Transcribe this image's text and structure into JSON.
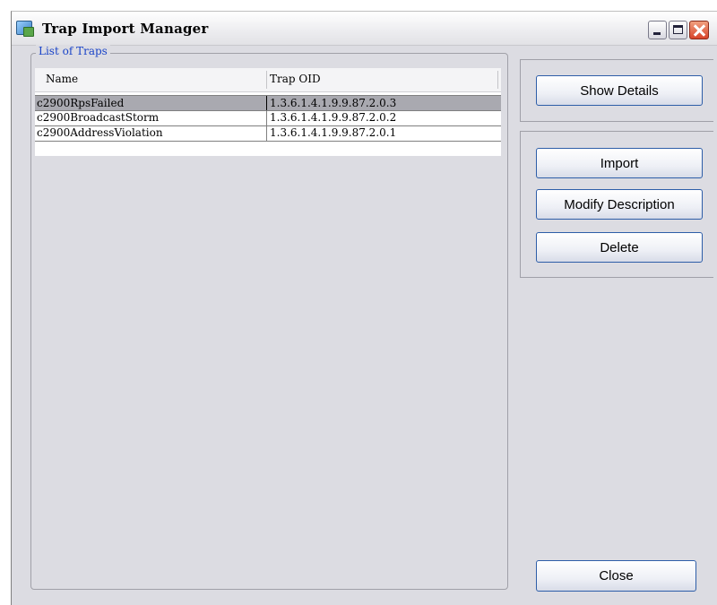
{
  "window": {
    "title": "Trap Import Manager",
    "icon": "app-icon"
  },
  "list": {
    "group_label": "List of Traps",
    "columns": [
      "Name",
      "Trap OID"
    ],
    "rows": [
      {
        "name": "c2900RpsFailed",
        "oid": "1.3.6.1.4.1.9.9.87.2.0.3",
        "selected": true
      },
      {
        "name": "c2900BroadcastStorm",
        "oid": "1.3.6.1.4.1.9.9.87.2.0.2",
        "selected": false
      },
      {
        "name": "c2900AddressViolation",
        "oid": "1.3.6.1.4.1.9.9.87.2.0.1",
        "selected": false
      }
    ]
  },
  "actions": {
    "show_details": "Show Details",
    "import": "Import",
    "modify_description": "Modify Description",
    "delete": "Delete",
    "close": "Close"
  },
  "colors": {
    "window_bg": "#dcdce2",
    "group_label": "#1a44c8",
    "selected_row": "#a9a9b0",
    "button_border": "#2e5ea8",
    "close_ctl": "#d8442a"
  }
}
